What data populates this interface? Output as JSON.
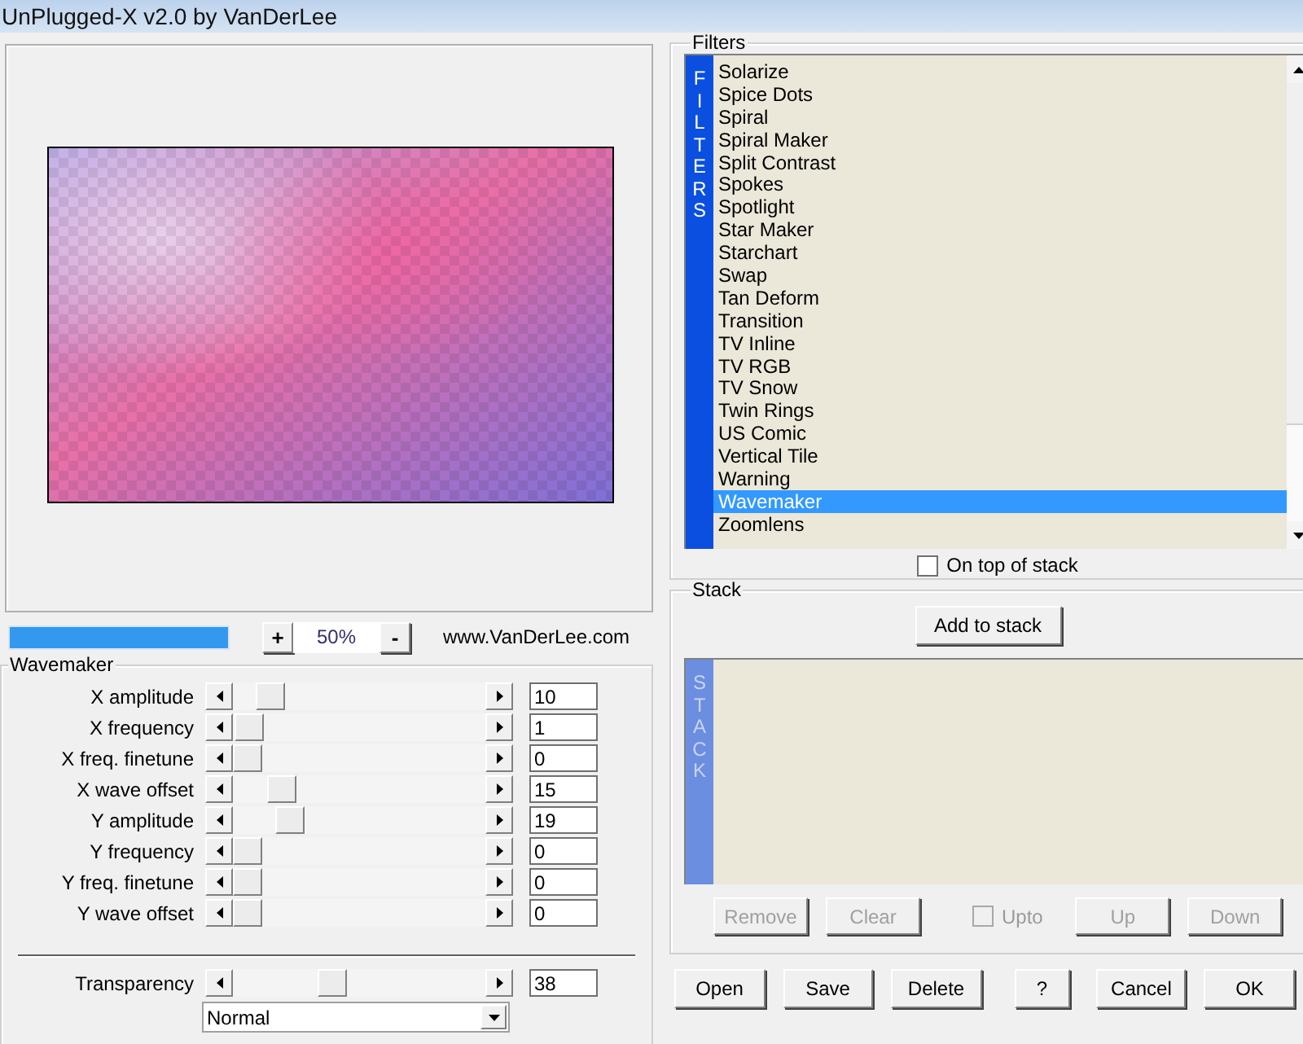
{
  "window": {
    "title": "UnPlugged-X v2.0 by VanDerLee"
  },
  "progress": {
    "level": 1
  },
  "zoom": {
    "plus": "+",
    "value": "50%",
    "minus": "-"
  },
  "website": "www.VanDerLee.com",
  "settings": {
    "title": "Wavemaker",
    "sliders": [
      {
        "label": "X amplitude",
        "value": "10",
        "level": 0.1
      },
      {
        "label": "X frequency",
        "value": "1",
        "level": 0.01
      },
      {
        "label": "X freq. finetune",
        "value": "0",
        "level": 0
      },
      {
        "label": "X wave offset",
        "value": "15",
        "level": 0.15
      },
      {
        "label": "Y amplitude",
        "value": "19",
        "level": 0.19
      },
      {
        "label": "Y frequency",
        "value": "0",
        "level": 0
      },
      {
        "label": "Y freq. finetune",
        "value": "0",
        "level": 0
      },
      {
        "label": "Y wave offset",
        "value": "0",
        "level": 0
      }
    ],
    "transparency": {
      "label": "Transparency",
      "value": "38",
      "level": 0.38
    },
    "blend_mode": "Normal"
  },
  "filters": {
    "title": "Filters",
    "strip": "FILTERS",
    "items": [
      {
        "label": "Solarize",
        "selected": false
      },
      {
        "label": "Spice Dots",
        "selected": false
      },
      {
        "label": "Spiral",
        "selected": false
      },
      {
        "label": "Spiral Maker",
        "selected": false
      },
      {
        "label": "Split Contrast",
        "selected": false
      },
      {
        "label": "Spokes",
        "selected": false
      },
      {
        "label": "Spotlight",
        "selected": false
      },
      {
        "label": "Star Maker",
        "selected": false
      },
      {
        "label": "Starchart",
        "selected": false
      },
      {
        "label": "Swap",
        "selected": false
      },
      {
        "label": "Tan Deform",
        "selected": false
      },
      {
        "label": "Transition",
        "selected": false
      },
      {
        "label": "TV Inline",
        "selected": false
      },
      {
        "label": "TV RGB",
        "selected": false
      },
      {
        "label": "TV Snow",
        "selected": false
      },
      {
        "label": "Twin Rings",
        "selected": false
      },
      {
        "label": "US Comic",
        "selected": false
      },
      {
        "label": "Vertical Tile",
        "selected": false
      },
      {
        "label": "Warning",
        "selected": false
      },
      {
        "label": "Wavemaker",
        "selected": true
      },
      {
        "label": "Zoomlens",
        "selected": false
      }
    ],
    "on_top_of_stack": {
      "label": "On top of stack",
      "checked": false
    }
  },
  "stack": {
    "title": "Stack",
    "add_button": "Add to stack",
    "strip": "STACK",
    "controls": [
      {
        "kind": "button",
        "label": "Remove",
        "disabled": true
      },
      {
        "kind": "button",
        "label": "Clear",
        "disabled": true
      },
      {
        "kind": "checkbox",
        "label": "Upto",
        "checked": false,
        "disabled": true
      },
      {
        "kind": "button",
        "label": "Up",
        "disabled": true
      },
      {
        "kind": "button",
        "label": "Down",
        "disabled": true
      }
    ]
  },
  "buttons": [
    "Open",
    "Save",
    "Delete",
    "?",
    "Cancel",
    "OK"
  ]
}
